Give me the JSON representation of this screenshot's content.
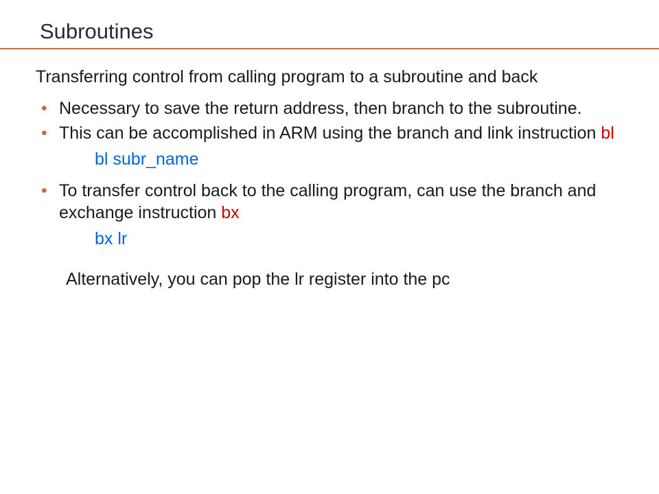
{
  "title": "Subroutines",
  "intro": "Transferring control from calling program to a subroutine and back",
  "bullets": {
    "b1": "Necessary to save the return address, then branch to the subroutine.",
    "b2_pre": "This can be accomplished in ARM using the branch and link instruction ",
    "b2_hl": "bl",
    "b3_pre": "To transfer control back to the calling program, can use the branch and exchange instruction ",
    "b3_hl": "bx"
  },
  "code": {
    "c1": "bl subr_name",
    "c2": "bx lr"
  },
  "alt_text": "Alternatively, you can pop the lr register into the pc"
}
